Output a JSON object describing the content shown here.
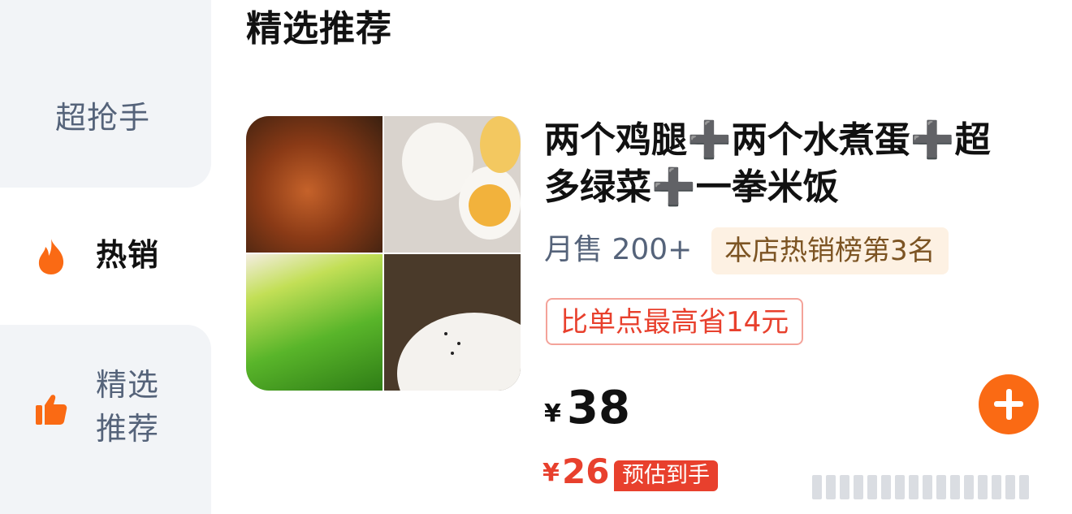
{
  "sidebar": {
    "items": [
      {
        "label": "超抢手",
        "active": false
      },
      {
        "label": "热销",
        "active": true,
        "icon": "flame-icon"
      },
      {
        "label_line1": "精选",
        "label_line2": "推荐",
        "active": false,
        "icon": "thumbs-up-icon"
      }
    ]
  },
  "section": {
    "title": "精选推荐"
  },
  "dish": {
    "name": "两个鸡腿➕两个水煮蛋➕超多绿菜➕一拳米饭",
    "monthly_sales": "月售 200+",
    "rank_badge": "本店热销榜第3名",
    "save_badge": "比单点最高省14元",
    "price_symbol": "¥",
    "price": "38",
    "est_symbol": "¥",
    "est_price": "26",
    "est_badge": "预估到手",
    "add_button": "add-icon"
  },
  "colors": {
    "accent_orange": "#fa6a14",
    "price_red": "#e8402d",
    "sidebar_bg": "#f2f4f7",
    "rank_badge_bg": "#fdf1e3"
  }
}
